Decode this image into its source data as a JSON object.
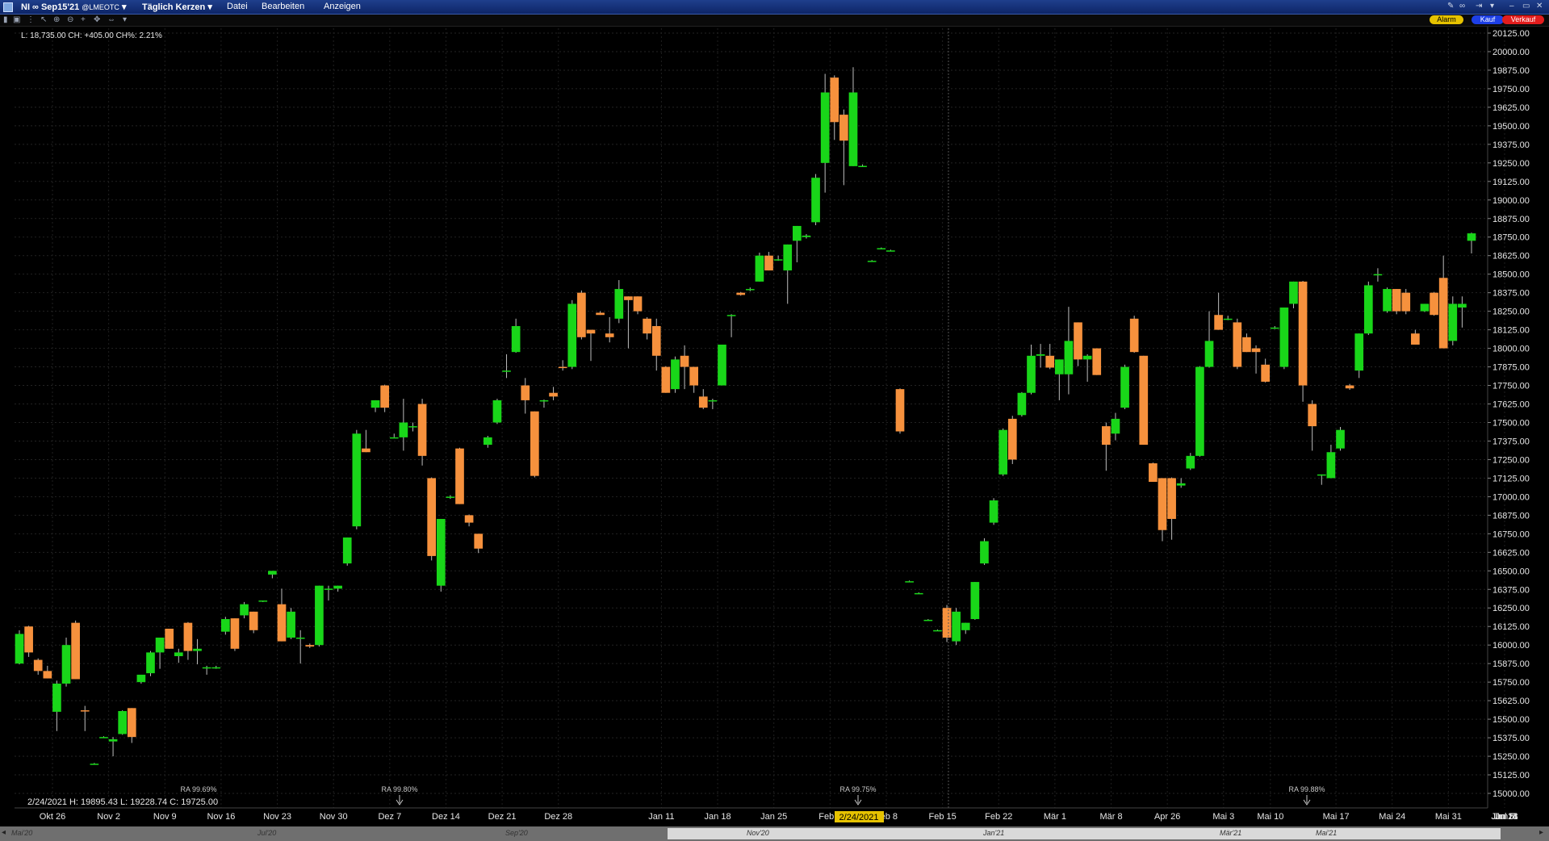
{
  "titlebar": {
    "symbol": "NI ∞ Sep15'21",
    "source": "@LMEOTC",
    "period": "Täglich Kerzen",
    "menus": [
      "Datei",
      "Bearbeiten",
      "Anzeigen"
    ]
  },
  "buttons": {
    "alarm": "Alarm",
    "buy": "Kauf",
    "sell": "Verkauf"
  },
  "info_top": "L: 18,735.00 CH: +405.00 CH%: 2.21%",
  "info_bottom": "2/24/2021   H: 19895.43   L: 19228.74   C: 19725.00",
  "crosshair_label": "2/24/2021",
  "scrollbar_labels": [
    "Mai'20",
    "Jul'20",
    "Sep'20",
    "Nov'20",
    "Jan'21",
    "Mär'21",
    "Mai'21"
  ],
  "colors": {
    "up": "#19d619",
    "down": "#f6913d",
    "background": "#000000",
    "grid": "#2a2a2a"
  },
  "chart_data": {
    "type": "candlestick",
    "ylim": [
      14900,
      20200
    ],
    "y_ticks": [
      20125,
      20000,
      19875,
      19750,
      19625,
      19500,
      19375,
      19250,
      19125,
      19000,
      18875,
      18750,
      18625,
      18500,
      18375,
      18250,
      18125,
      18000,
      17875,
      17750,
      17625,
      17500,
      17375,
      17250,
      17125,
      17000,
      16875,
      16750,
      16625,
      16500,
      16375,
      16250,
      16125,
      16000,
      15875,
      15750,
      15625,
      15500,
      15375,
      15250,
      15125,
      15000
    ],
    "x_labels": [
      "Okt 26",
      "Nov 2",
      "Nov 9",
      "Nov 16",
      "Nov 23",
      "Nov 30",
      "Dez 7",
      "Dez 14",
      "Dez 21",
      "Dez 28",
      "Jan 11",
      "Jan 18",
      "Jan 25",
      "Feb 1",
      "Feb 8",
      "Feb 15",
      "Feb 22",
      "Mär 1",
      "Mär 8",
      "Apr 26",
      "Mai 3",
      "Mai 10",
      "Mai 17",
      "Mai 24",
      "Mai 31",
      "Jun 7",
      "Jun 14",
      "Jun 21",
      "Jun 28",
      "Jul 5"
    ],
    "annotations": [
      "RA 99.69%",
      "RA 99.80%",
      "RA 99.75%",
      "RA 99.88%"
    ],
    "candles": [
      {
        "o": 15875,
        "h": 16100,
        "l": 15870,
        "c": 16075
      },
      {
        "o": 16125,
        "h": 16130,
        "l": 15920,
        "c": 15950
      },
      {
        "o": 15900,
        "h": 15910,
        "l": 15800,
        "c": 15825
      },
      {
        "o": 15825,
        "h": 15860,
        "l": 15785,
        "c": 15775
      },
      {
        "o": 15550,
        "h": 15760,
        "l": 15420,
        "c": 15740
      },
      {
        "o": 15740,
        "h": 16050,
        "l": 15720,
        "c": 16000
      },
      {
        "o": 16150,
        "h": 16165,
        "l": 15770,
        "c": 15770
      },
      {
        "o": 15560,
        "h": 15590,
        "l": 15420,
        "c": 15555
      },
      {
        "o": 15200,
        "h": 15205,
        "l": 15195,
        "c": 15200
      },
      {
        "o": 15380,
        "h": 15385,
        "l": 15375,
        "c": 15380
      },
      {
        "o": 15350,
        "h": 15380,
        "l": 15250,
        "c": 15365
      },
      {
        "o": 15400,
        "h": 15560,
        "l": 15395,
        "c": 15555
      },
      {
        "o": 15575,
        "h": 15575,
        "l": 15340,
        "c": 15380
      },
      {
        "o": 15750,
        "h": 15770,
        "l": 15740,
        "c": 15800
      },
      {
        "o": 15810,
        "h": 15960,
        "l": 15790,
        "c": 15950
      },
      {
        "o": 15950,
        "h": 16050,
        "l": 15840,
        "c": 16050
      },
      {
        "o": 16110,
        "h": 16110,
        "l": 15975,
        "c": 15975
      },
      {
        "o": 15925,
        "h": 15975,
        "l": 15880,
        "c": 15950
      },
      {
        "o": 16150,
        "h": 16155,
        "l": 15900,
        "c": 15960
      },
      {
        "o": 15960,
        "h": 16040,
        "l": 15870,
        "c": 15975
      },
      {
        "o": 15850,
        "h": 15860,
        "l": 15800,
        "c": 15850
      },
      {
        "o": 15850,
        "h": 15860,
        "l": 15840,
        "c": 15850
      },
      {
        "o": 16090,
        "h": 16190,
        "l": 16070,
        "c": 16175
      },
      {
        "o": 16180,
        "h": 16180,
        "l": 15960,
        "c": 15975
      },
      {
        "o": 16200,
        "h": 16290,
        "l": 16180,
        "c": 16275
      },
      {
        "o": 16225,
        "h": 16225,
        "l": 16080,
        "c": 16100
      },
      {
        "o": 16300,
        "h": 16300,
        "l": 16290,
        "c": 16300
      },
      {
        "o": 16475,
        "h": 16500,
        "l": 16450,
        "c": 16500
      },
      {
        "o": 16275,
        "h": 16380,
        "l": 16030,
        "c": 16025
      },
      {
        "o": 16050,
        "h": 16250,
        "l": 16040,
        "c": 16225
      },
      {
        "o": 16050,
        "h": 16100,
        "l": 15875,
        "c": 16050
      },
      {
        "o": 16000,
        "h": 16010,
        "l": 15980,
        "c": 15990
      },
      {
        "o": 16000,
        "h": 16400,
        "l": 15990,
        "c": 16400
      },
      {
        "o": 16375,
        "h": 16400,
        "l": 16300,
        "c": 16380
      },
      {
        "o": 16380,
        "h": 16400,
        "l": 16360,
        "c": 16400
      },
      {
        "o": 16550,
        "h": 16580,
        "l": 16535,
        "c": 16725
      },
      {
        "o": 16800,
        "h": 17450,
        "l": 16780,
        "c": 17425
      },
      {
        "o": 17325,
        "h": 17450,
        "l": 17310,
        "c": 17300
      },
      {
        "o": 17600,
        "h": 17625,
        "l": 17570,
        "c": 17650
      },
      {
        "o": 17750,
        "h": 17755,
        "l": 17570,
        "c": 17600
      },
      {
        "o": 17400,
        "h": 17425,
        "l": 17400,
        "c": 17400
      },
      {
        "o": 17400,
        "h": 17660,
        "l": 17310,
        "c": 17500
      },
      {
        "o": 17475,
        "h": 17500,
        "l": 17440,
        "c": 17475
      },
      {
        "o": 17625,
        "h": 17660,
        "l": 17210,
        "c": 17275
      },
      {
        "o": 17125,
        "h": 17130,
        "l": 16570,
        "c": 16600
      },
      {
        "o": 16400,
        "h": 16375,
        "l": 16360,
        "c": 16850
      },
      {
        "o": 17000,
        "h": 17010,
        "l": 16985,
        "c": 17000
      },
      {
        "o": 17325,
        "h": 17330,
        "l": 16950,
        "c": 16950
      },
      {
        "o": 16875,
        "h": 16880,
        "l": 16800,
        "c": 16825
      },
      {
        "o": 16750,
        "h": 16750,
        "l": 16620,
        "c": 16650
      },
      {
        "o": 17350,
        "h": 17410,
        "l": 17330,
        "c": 17400
      },
      {
        "o": 17500,
        "h": 17660,
        "l": 17490,
        "c": 17650
      },
      {
        "o": 17850,
        "h": 17960,
        "l": 17800,
        "c": 17850
      },
      {
        "o": 17975,
        "h": 18200,
        "l": 17970,
        "c": 18150
      },
      {
        "o": 17750,
        "h": 17800,
        "l": 17560,
        "c": 17650
      },
      {
        "o": 17575,
        "h": 17575,
        "l": 17130,
        "c": 17140
      },
      {
        "o": 17650,
        "h": 17655,
        "l": 17600,
        "c": 17650
      },
      {
        "o": 17700,
        "h": 17740,
        "l": 17650,
        "c": 17675
      },
      {
        "o": 17875,
        "h": 17920,
        "l": 17850,
        "c": 17870
      },
      {
        "o": 17875,
        "h": 18325,
        "l": 17860,
        "c": 18300
      },
      {
        "o": 18375,
        "h": 18390,
        "l": 18060,
        "c": 18075
      },
      {
        "o": 18125,
        "h": 18125,
        "l": 17915,
        "c": 18100
      },
      {
        "o": 18240,
        "h": 18250,
        "l": 18225,
        "c": 18225
      },
      {
        "o": 18100,
        "h": 18210,
        "l": 18040,
        "c": 18075
      },
      {
        "o": 18200,
        "h": 18460,
        "l": 18170,
        "c": 18400
      },
      {
        "o": 18350,
        "h": 18350,
        "l": 18000,
        "c": 18325
      },
      {
        "o": 18350,
        "h": 18350,
        "l": 18230,
        "c": 18250
      },
      {
        "o": 18200,
        "h": 18210,
        "l": 18060,
        "c": 18100
      },
      {
        "o": 18150,
        "h": 18200,
        "l": 17850,
        "c": 17950
      },
      {
        "o": 17875,
        "h": 17880,
        "l": 17700,
        "c": 17700
      },
      {
        "o": 17725,
        "h": 17945,
        "l": 17700,
        "c": 17925
      },
      {
        "o": 17950,
        "h": 18020,
        "l": 17725,
        "c": 17875
      },
      {
        "o": 17875,
        "h": 17875,
        "l": 17700,
        "c": 17750
      },
      {
        "o": 17675,
        "h": 17725,
        "l": 17590,
        "c": 17600
      },
      {
        "o": 17650,
        "h": 17660,
        "l": 17590,
        "c": 17650
      },
      {
        "o": 17750,
        "h": 18020,
        "l": 17750,
        "c": 18025
      },
      {
        "o": 18225,
        "h": 18230,
        "l": 18075,
        "c": 18225
      },
      {
        "o": 18375,
        "h": 18380,
        "l": 18355,
        "c": 18360
      },
      {
        "o": 18400,
        "h": 18410,
        "l": 18385,
        "c": 18400
      },
      {
        "o": 18450,
        "h": 18645,
        "l": 18455,
        "c": 18625
      },
      {
        "o": 18625,
        "h": 18650,
        "l": 18555,
        "c": 18525
      },
      {
        "o": 18600,
        "h": 18625,
        "l": 18590,
        "c": 18600
      },
      {
        "o": 18525,
        "h": 18620,
        "l": 18300,
        "c": 18700
      },
      {
        "o": 18725,
        "h": 18740,
        "l": 18580,
        "c": 18825
      },
      {
        "o": 18750,
        "h": 18770,
        "l": 18740,
        "c": 18760
      },
      {
        "o": 18850,
        "h": 19175,
        "l": 18830,
        "c": 19150
      },
      {
        "o": 19250,
        "h": 19850,
        "l": 19050,
        "c": 19725
      },
      {
        "o": 19825,
        "h": 19840,
        "l": 19405,
        "c": 19525
      },
      {
        "o": 19575,
        "h": 19610,
        "l": 19100,
        "c": 19400
      },
      {
        "o": 19228,
        "h": 19895,
        "l": 19229,
        "c": 19725
      },
      {
        "o": 19230,
        "h": 19240,
        "l": 19225,
        "c": 19230
      },
      {
        "o": 18590,
        "h": 18595,
        "l": 18585,
        "c": 18590
      },
      {
        "o": 18675,
        "h": 18680,
        "l": 18670,
        "c": 18675
      },
      {
        "o": 18660,
        "h": 18665,
        "l": 18655,
        "c": 18660
      },
      {
        "o": 17725,
        "h": 17730,
        "l": 17425,
        "c": 17440
      },
      {
        "o": 16430,
        "h": 16435,
        "l": 16425,
        "c": 16430
      },
      {
        "o": 16350,
        "h": 16355,
        "l": 16345,
        "c": 16350
      },
      {
        "o": 16170,
        "h": 16175,
        "l": 16165,
        "c": 16170
      },
      {
        "o": 16100,
        "h": 16105,
        "l": 16095,
        "c": 16100
      },
      {
        "o": 16250,
        "h": 16270,
        "l": 16020,
        "c": 16050
      },
      {
        "o": 16025,
        "h": 16250,
        "l": 16000,
        "c": 16225
      },
      {
        "o": 16100,
        "h": 16100,
        "l": 16075,
        "c": 16150
      },
      {
        "o": 16175,
        "h": 16425,
        "l": 16170,
        "c": 16425
      },
      {
        "o": 16550,
        "h": 16720,
        "l": 16540,
        "c": 16700
      },
      {
        "o": 16825,
        "h": 16990,
        "l": 16810,
        "c": 16975
      },
      {
        "o": 17150,
        "h": 17460,
        "l": 17140,
        "c": 17450
      },
      {
        "o": 17525,
        "h": 17545,
        "l": 17220,
        "c": 17250
      },
      {
        "o": 17550,
        "h": 17705,
        "l": 17540,
        "c": 17700
      },
      {
        "o": 17700,
        "h": 18025,
        "l": 17690,
        "c": 17950
      },
      {
        "o": 17950,
        "h": 18030,
        "l": 17870,
        "c": 17960
      },
      {
        "o": 17950,
        "h": 18030,
        "l": 17860,
        "c": 17870
      },
      {
        "o": 17825,
        "h": 17875,
        "l": 17650,
        "c": 17925
      },
      {
        "o": 17825,
        "h": 18280,
        "l": 17690,
        "c": 18050
      },
      {
        "o": 18175,
        "h": 18175,
        "l": 17880,
        "c": 17925
      },
      {
        "o": 17925,
        "h": 17960,
        "l": 17775,
        "c": 17950
      },
      {
        "o": 18000,
        "h": 18000,
        "l": 17820,
        "c": 17820
      },
      {
        "o": 17475,
        "h": 17500,
        "l": 17175,
        "c": 17350
      },
      {
        "o": 17425,
        "h": 17565,
        "l": 17380,
        "c": 17525
      },
      {
        "o": 17600,
        "h": 17890,
        "l": 17590,
        "c": 17875
      },
      {
        "o": 18200,
        "h": 18220,
        "l": 17970,
        "c": 17975
      },
      {
        "o": 17950,
        "h": 17950,
        "l": 17400,
        "c": 17350
      },
      {
        "o": 17225,
        "h": 17230,
        "l": 17100,
        "c": 17100
      },
      {
        "o": 17125,
        "h": 17125,
        "l": 16700,
        "c": 16775
      },
      {
        "o": 17125,
        "h": 17130,
        "l": 16710,
        "c": 16850
      },
      {
        "o": 17075,
        "h": 17125,
        "l": 17060,
        "c": 17090
      },
      {
        "o": 17190,
        "h": 17295,
        "l": 17180,
        "c": 17275
      },
      {
        "o": 17275,
        "h": 17880,
        "l": 17270,
        "c": 17875
      },
      {
        "o": 17875,
        "h": 18250,
        "l": 17870,
        "c": 18050
      },
      {
        "o": 18225,
        "h": 18375,
        "l": 18215,
        "c": 18125
      },
      {
        "o": 18200,
        "h": 18220,
        "l": 18190,
        "c": 18200
      },
      {
        "o": 18175,
        "h": 18200,
        "l": 17860,
        "c": 17875
      },
      {
        "o": 18075,
        "h": 18100,
        "l": 17990,
        "c": 17975
      },
      {
        "o": 18000,
        "h": 18020,
        "l": 17830,
        "c": 17975
      },
      {
        "o": 17890,
        "h": 17930,
        "l": 17770,
        "c": 17775
      },
      {
        "o": 18140,
        "h": 18150,
        "l": 18130,
        "c": 18140
      },
      {
        "o": 17875,
        "h": 18275,
        "l": 17860,
        "c": 18275
      },
      {
        "o": 18300,
        "h": 18450,
        "l": 18270,
        "c": 18450
      },
      {
        "o": 18450,
        "h": 18455,
        "l": 17640,
        "c": 17750
      },
      {
        "o": 17625,
        "h": 17650,
        "l": 17310,
        "c": 17475
      },
      {
        "o": 17150,
        "h": 17150,
        "l": 17080,
        "c": 17150
      },
      {
        "o": 17125,
        "h": 17350,
        "l": 17130,
        "c": 17300
      },
      {
        "o": 17325,
        "h": 17470,
        "l": 17310,
        "c": 17450
      },
      {
        "o": 17750,
        "h": 17760,
        "l": 17720,
        "c": 17730
      },
      {
        "o": 17850,
        "h": 17860,
        "l": 17800,
        "c": 18100
      },
      {
        "o": 18100,
        "h": 18450,
        "l": 18090,
        "c": 18425
      },
      {
        "o": 18500,
        "h": 18540,
        "l": 18450,
        "c": 18500
      },
      {
        "o": 18250,
        "h": 18410,
        "l": 18240,
        "c": 18400
      },
      {
        "o": 18400,
        "h": 18400,
        "l": 18230,
        "c": 18250
      },
      {
        "o": 18375,
        "h": 18400,
        "l": 18230,
        "c": 18250
      },
      {
        "o": 18100,
        "h": 18125,
        "l": 18030,
        "c": 18025
      },
      {
        "o": 18250,
        "h": 18300,
        "l": 18245,
        "c": 18300
      },
      {
        "o": 18375,
        "h": 18380,
        "l": 18220,
        "c": 18225
      },
      {
        "o": 18475,
        "h": 18625,
        "l": 18000,
        "c": 18000
      },
      {
        "o": 18050,
        "h": 18350,
        "l": 18020,
        "c": 18300
      },
      {
        "o": 18275,
        "h": 18350,
        "l": 18140,
        "c": 18300
      },
      {
        "o": 18725,
        "h": 18780,
        "l": 18640,
        "c": 18775
      }
    ]
  }
}
